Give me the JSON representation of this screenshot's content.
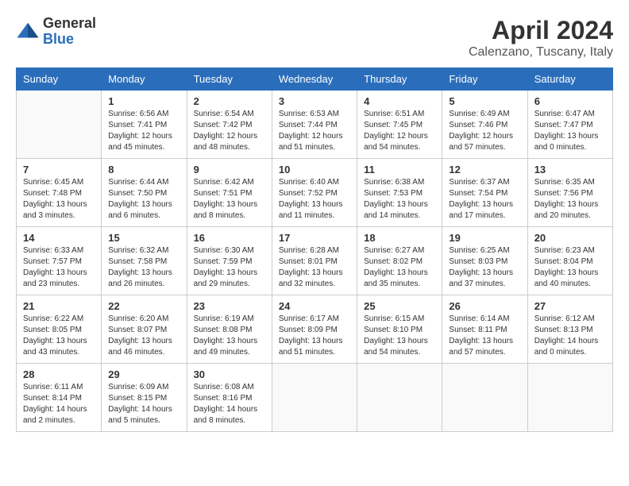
{
  "header": {
    "logo_general": "General",
    "logo_blue": "Blue",
    "month_title": "April 2024",
    "location": "Calenzano, Tuscany, Italy"
  },
  "weekdays": [
    "Sunday",
    "Monday",
    "Tuesday",
    "Wednesday",
    "Thursday",
    "Friday",
    "Saturday"
  ],
  "weeks": [
    [
      {
        "day": "",
        "info": ""
      },
      {
        "day": "1",
        "info": "Sunrise: 6:56 AM\nSunset: 7:41 PM\nDaylight: 12 hours\nand 45 minutes."
      },
      {
        "day": "2",
        "info": "Sunrise: 6:54 AM\nSunset: 7:42 PM\nDaylight: 12 hours\nand 48 minutes."
      },
      {
        "day": "3",
        "info": "Sunrise: 6:53 AM\nSunset: 7:44 PM\nDaylight: 12 hours\nand 51 minutes."
      },
      {
        "day": "4",
        "info": "Sunrise: 6:51 AM\nSunset: 7:45 PM\nDaylight: 12 hours\nand 54 minutes."
      },
      {
        "day": "5",
        "info": "Sunrise: 6:49 AM\nSunset: 7:46 PM\nDaylight: 12 hours\nand 57 minutes."
      },
      {
        "day": "6",
        "info": "Sunrise: 6:47 AM\nSunset: 7:47 PM\nDaylight: 13 hours\nand 0 minutes."
      }
    ],
    [
      {
        "day": "7",
        "info": "Sunrise: 6:45 AM\nSunset: 7:48 PM\nDaylight: 13 hours\nand 3 minutes."
      },
      {
        "day": "8",
        "info": "Sunrise: 6:44 AM\nSunset: 7:50 PM\nDaylight: 13 hours\nand 6 minutes."
      },
      {
        "day": "9",
        "info": "Sunrise: 6:42 AM\nSunset: 7:51 PM\nDaylight: 13 hours\nand 8 minutes."
      },
      {
        "day": "10",
        "info": "Sunrise: 6:40 AM\nSunset: 7:52 PM\nDaylight: 13 hours\nand 11 minutes."
      },
      {
        "day": "11",
        "info": "Sunrise: 6:38 AM\nSunset: 7:53 PM\nDaylight: 13 hours\nand 14 minutes."
      },
      {
        "day": "12",
        "info": "Sunrise: 6:37 AM\nSunset: 7:54 PM\nDaylight: 13 hours\nand 17 minutes."
      },
      {
        "day": "13",
        "info": "Sunrise: 6:35 AM\nSunset: 7:56 PM\nDaylight: 13 hours\nand 20 minutes."
      }
    ],
    [
      {
        "day": "14",
        "info": "Sunrise: 6:33 AM\nSunset: 7:57 PM\nDaylight: 13 hours\nand 23 minutes."
      },
      {
        "day": "15",
        "info": "Sunrise: 6:32 AM\nSunset: 7:58 PM\nDaylight: 13 hours\nand 26 minutes."
      },
      {
        "day": "16",
        "info": "Sunrise: 6:30 AM\nSunset: 7:59 PM\nDaylight: 13 hours\nand 29 minutes."
      },
      {
        "day": "17",
        "info": "Sunrise: 6:28 AM\nSunset: 8:01 PM\nDaylight: 13 hours\nand 32 minutes."
      },
      {
        "day": "18",
        "info": "Sunrise: 6:27 AM\nSunset: 8:02 PM\nDaylight: 13 hours\nand 35 minutes."
      },
      {
        "day": "19",
        "info": "Sunrise: 6:25 AM\nSunset: 8:03 PM\nDaylight: 13 hours\nand 37 minutes."
      },
      {
        "day": "20",
        "info": "Sunrise: 6:23 AM\nSunset: 8:04 PM\nDaylight: 13 hours\nand 40 minutes."
      }
    ],
    [
      {
        "day": "21",
        "info": "Sunrise: 6:22 AM\nSunset: 8:05 PM\nDaylight: 13 hours\nand 43 minutes."
      },
      {
        "day": "22",
        "info": "Sunrise: 6:20 AM\nSunset: 8:07 PM\nDaylight: 13 hours\nand 46 minutes."
      },
      {
        "day": "23",
        "info": "Sunrise: 6:19 AM\nSunset: 8:08 PM\nDaylight: 13 hours\nand 49 minutes."
      },
      {
        "day": "24",
        "info": "Sunrise: 6:17 AM\nSunset: 8:09 PM\nDaylight: 13 hours\nand 51 minutes."
      },
      {
        "day": "25",
        "info": "Sunrise: 6:15 AM\nSunset: 8:10 PM\nDaylight: 13 hours\nand 54 minutes."
      },
      {
        "day": "26",
        "info": "Sunrise: 6:14 AM\nSunset: 8:11 PM\nDaylight: 13 hours\nand 57 minutes."
      },
      {
        "day": "27",
        "info": "Sunrise: 6:12 AM\nSunset: 8:13 PM\nDaylight: 14 hours\nand 0 minutes."
      }
    ],
    [
      {
        "day": "28",
        "info": "Sunrise: 6:11 AM\nSunset: 8:14 PM\nDaylight: 14 hours\nand 2 minutes."
      },
      {
        "day": "29",
        "info": "Sunrise: 6:09 AM\nSunset: 8:15 PM\nDaylight: 14 hours\nand 5 minutes."
      },
      {
        "day": "30",
        "info": "Sunrise: 6:08 AM\nSunset: 8:16 PM\nDaylight: 14 hours\nand 8 minutes."
      },
      {
        "day": "",
        "info": ""
      },
      {
        "day": "",
        "info": ""
      },
      {
        "day": "",
        "info": ""
      },
      {
        "day": "",
        "info": ""
      }
    ]
  ]
}
